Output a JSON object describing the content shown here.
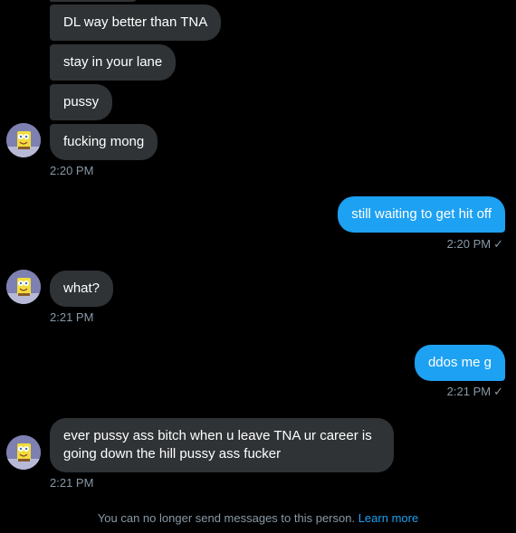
{
  "colors": {
    "background": "#000000",
    "incoming_bubble": "#2f3336",
    "outgoing_bubble": "#1da1f2",
    "timestamp": "#8899a6",
    "link": "#1da1f2"
  },
  "messages": [
    {
      "direction": "incoming",
      "text": "DL way better than TNA"
    },
    {
      "direction": "incoming",
      "text": "stay in your lane"
    },
    {
      "direction": "incoming",
      "text": "pussy"
    },
    {
      "direction": "incoming",
      "text": "fucking mong",
      "time": "2:20 PM",
      "avatar_icon": "spongebob-avatar-icon"
    },
    {
      "direction": "outgoing",
      "text": "still waiting to get hit off",
      "time": "2:20 PM",
      "status_icon": "checkmark-icon"
    },
    {
      "direction": "incoming",
      "text": "what?",
      "time": "2:21 PM",
      "avatar_icon": "spongebob-avatar-icon"
    },
    {
      "direction": "outgoing",
      "text": "ddos me g",
      "time": "2:21 PM",
      "status_icon": "checkmark-icon"
    },
    {
      "direction": "incoming",
      "text": "ever pussy ass bitch when u leave TNA ur career is going down the hill pussy ass fucker",
      "time": "2:21 PM",
      "avatar_icon": "spongebob-avatar-icon"
    }
  ],
  "check_glyph": "✓",
  "footer": {
    "notice": "You can no longer send messages to this person.",
    "link_label": "Learn more"
  }
}
